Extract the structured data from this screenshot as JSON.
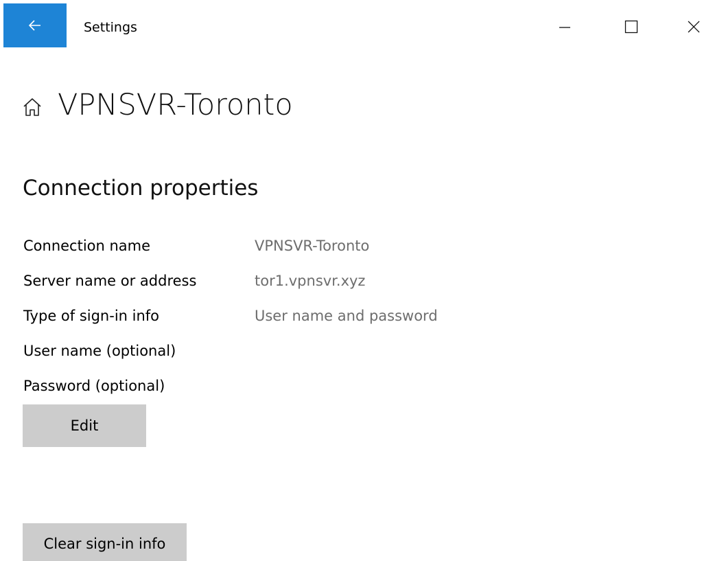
{
  "titlebar": {
    "app_title": "Settings",
    "back_icon": "arrow-left-icon",
    "accent_color": "#1e84d6",
    "controls": [
      "minimize-icon",
      "maximize-icon",
      "close-icon"
    ]
  },
  "header": {
    "home_icon": "home-icon",
    "title": "VPNSVR-Toronto"
  },
  "section": {
    "title": "Connection properties"
  },
  "properties": [
    {
      "label": "Connection name",
      "value": "VPNSVR-Toronto"
    },
    {
      "label": "Server name or address",
      "value": "tor1.vpnsvr.xyz"
    },
    {
      "label": "Type of sign-in info",
      "value": "User name and password"
    },
    {
      "label": "User name (optional)",
      "value": ""
    },
    {
      "label": "Password (optional)",
      "value": ""
    }
  ],
  "buttons": {
    "edit_label": "Edit",
    "clear_label": "Clear sign-in info"
  }
}
